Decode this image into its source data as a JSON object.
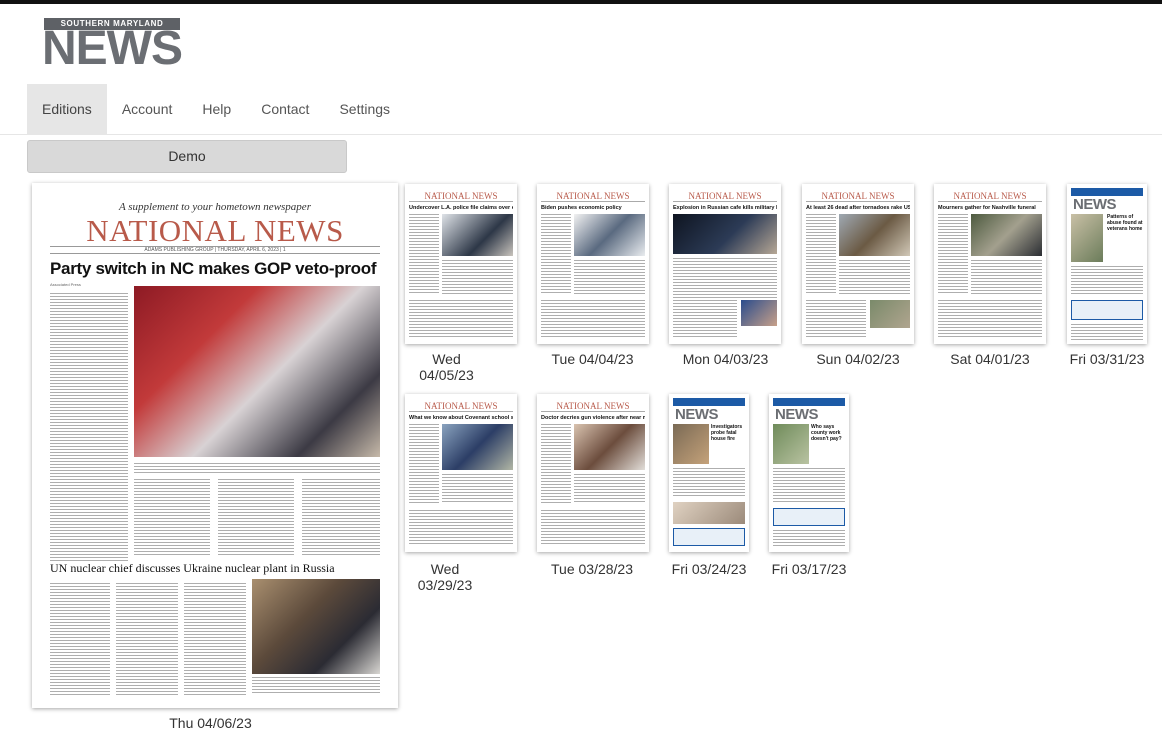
{
  "logo": {
    "tagline": "SOUTHERN MARYLAND",
    "word": "NEWS"
  },
  "nav": {
    "items": [
      {
        "label": "Editions",
        "active": true
      },
      {
        "label": "Account",
        "active": false
      },
      {
        "label": "Help",
        "active": false
      },
      {
        "label": "Contact",
        "active": false
      },
      {
        "label": "Settings",
        "active": false
      }
    ]
  },
  "demo_button": "Demo",
  "featured": {
    "supplement": "A supplement to your hometown newspaper",
    "masthead": "NATIONAL NEWS",
    "dateline": "ADAMS PUBLISHING GROUP | THURSDAY, APRIL 6, 2023 | 1",
    "headline": "Party switch in NC makes GOP veto-proof",
    "byline": "Associated Press",
    "headline2": "UN nuclear chief discusses Ukraine nuclear plant in Russia",
    "date": "Thu 04/06/23"
  },
  "editions": [
    {
      "date": "Wed 04/05/23",
      "headline": "Undercover L.A. police file claims over exposure",
      "type": "national"
    },
    {
      "date": "Tue 04/04/23",
      "headline": "Biden pushes economic policy",
      "type": "national"
    },
    {
      "date": "Mon 04/03/23",
      "headline": "Explosion in Russian cafe kills military blogger",
      "type": "national"
    },
    {
      "date": "Sun 04/02/23",
      "headline": "At least 26 dead after tornadoes rake US",
      "type": "national"
    },
    {
      "date": "Sat 04/01/23",
      "headline": "Mourners gather for Nashville funeral",
      "type": "national"
    },
    {
      "date": "Fri 03/31/23",
      "headline": "Patterns of abuse found at veterans home",
      "type": "local"
    },
    {
      "date": "Wed 03/29/23",
      "headline": "What we know about Covenant school shooting",
      "type": "national"
    },
    {
      "date": "Tue 03/28/23",
      "headline": "Doctor decries gun violence after near miss",
      "type": "national"
    },
    {
      "date": "Fri 03/24/23",
      "headline": "Investigators probe fatal house fire",
      "type": "local"
    },
    {
      "date": "Fri 03/17/23",
      "headline": "Who says county work doesn't pay?",
      "type": "local"
    }
  ],
  "colors": {
    "masthead": "#b85a4a",
    "logo_gray": "#6b6e73",
    "local_blue": "#1c5aa6",
    "nav_active_bg": "#e6e6e6"
  }
}
